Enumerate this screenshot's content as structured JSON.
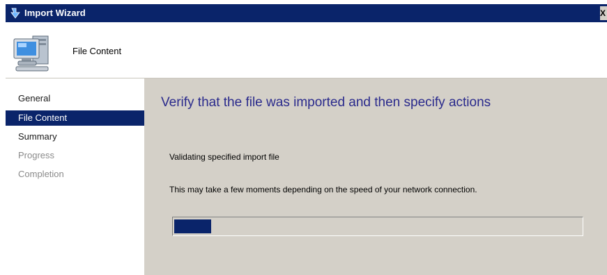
{
  "window": {
    "title": "Import Wizard",
    "close_label": "X"
  },
  "header": {
    "page_name": "File Content",
    "icon": "computer-icon"
  },
  "nav": {
    "items": [
      {
        "label": "General",
        "state": "done"
      },
      {
        "label": "File Content",
        "state": "selected"
      },
      {
        "label": "Summary",
        "state": "done"
      },
      {
        "label": "Progress",
        "state": "future"
      },
      {
        "label": "Completion",
        "state": "future"
      }
    ]
  },
  "content": {
    "title": "Verify that the file was imported and then specify actions",
    "status_line": "Validating specified import file",
    "info_line": "This may take a few moments depending on the speed of your network connection.",
    "progress_percent": 9
  },
  "colors": {
    "titlebar": "#0a246a",
    "selection": "#0a246a",
    "heading": "#2a2a8c",
    "panel": "#d4d0c8"
  }
}
